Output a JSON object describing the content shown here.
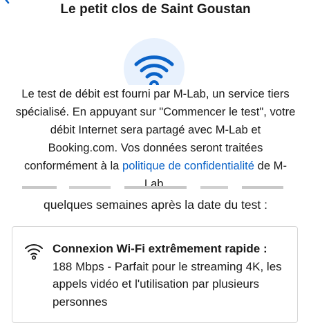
{
  "header": {
    "title": "Le petit clos de Saint Goustan"
  },
  "consent": {
    "text_before_link": "Le test de débit est fourni par M-Lab, un service tiers spécialisé. En appuyant sur \"Commencer le test\", votre débit Internet sera partagé avec M-Lab et Booking.com. Vos données seront traitées conformément à la ",
    "link_label": "politique de confidentialité",
    "text_after_link": " de M-Lab."
  },
  "main": {
    "caption": "quelques semaines après la date du test :"
  },
  "result_card": {
    "icon": "wifi-icon",
    "title": "Connexion Wi-Fi extrêmement rapide :",
    "description": " 188 Mbps - Parfait pour le streaming 4K, les appels vidéo et l'utilisation par plusieurs personnes"
  },
  "colors": {
    "accent": "#0b63c8",
    "icon_bg": "#e8f1fd",
    "text": "#1a1a1a",
    "border": "#d7d7d7"
  }
}
